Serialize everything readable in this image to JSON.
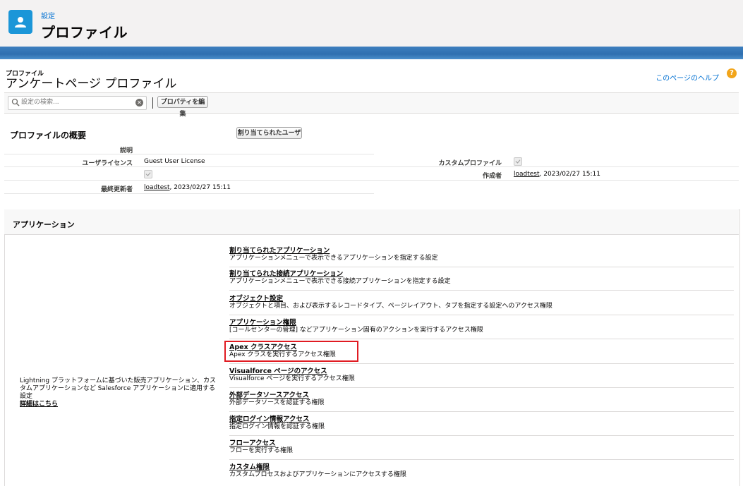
{
  "header": {
    "breadcrumb": "設定",
    "title": "プロファイル",
    "icon": "user-icon"
  },
  "page": {
    "object_label": "プロファイル",
    "name": "アンケートページ プロファイル",
    "help_link": "このページのヘルプ"
  },
  "toolbar": {
    "search_placeholder": "設定の検索...",
    "edit_properties_label": "プロパティを編集"
  },
  "overview": {
    "title": "プロファイルの概要",
    "assigned_users_label": "割り当てられたユーザ",
    "description_label": "説明",
    "description_value": "",
    "user_license_label": "ユーザライセンス",
    "user_license_value": "Guest User License",
    "custom_profile_label": "カスタムプロファイル",
    "custom_profile_checked": true,
    "created_by_label": "作成者",
    "created_by_user": "loadtest",
    "created_by_date": ", 2023/02/27 15:11",
    "modified_by_label": "最終更新者",
    "modified_by_user": "loadtest",
    "modified_by_date": ", 2023/02/27 15:11"
  },
  "apps": {
    "section_title": "アプリケーション",
    "description": "Lightning プラットフォームに基づいた販売アプリケーション、カスタムアプリケーションなど Salesforce アプリケーションに適用する設定",
    "more_link": "詳細はこちら",
    "items": [
      {
        "title": "割り当てられたアプリケーション",
        "desc": "アプリケーションメニューで表示できるアプリケーションを指定する設定"
      },
      {
        "title": "割り当てられた接続アプリケーション",
        "desc": "アプリケーションメニューで表示できる接続アプリケーションを指定する設定"
      },
      {
        "title": "オブジェクト設定",
        "desc": "オブジェクトと項目、および表示するレコードタイプ、ページレイアウト、タブを指定する設定へのアクセス権限"
      },
      {
        "title": "アプリケーション権限",
        "desc": "[コールセンターの管理] などアプリケーション固有のアクションを実行するアクセス権限"
      },
      {
        "title": "Apex クラスアクセス",
        "desc": "Apex クラスを実行するアクセス権限"
      },
      {
        "title": "Visualforce ページのアクセス",
        "desc": "Visualforce ページを実行するアクセス権限"
      },
      {
        "title": "外部データソースアクセス",
        "desc": "外部データソースを認証する権限"
      },
      {
        "title": "指定ログイン情報アクセス",
        "desc": "指定ログイン情報を認証する権限"
      },
      {
        "title": "フローアクセス",
        "desc": "フローを実行する権限"
      },
      {
        "title": "カスタム権限",
        "desc": "カスタムプロセスおよびアプリケーションにアクセスする権限"
      }
    ]
  },
  "colors": {
    "accent": "#1b96d8",
    "highlight": "#e01b22",
    "link": "#0070d2"
  }
}
